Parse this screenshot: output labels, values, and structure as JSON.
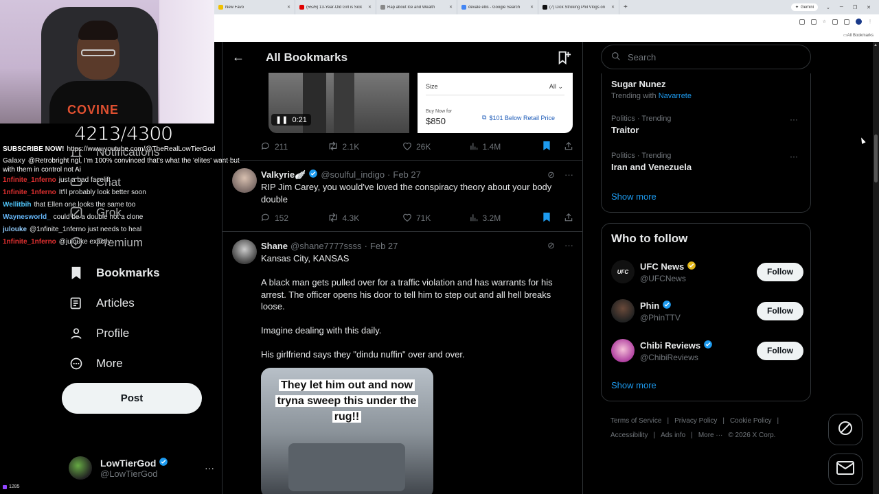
{
  "browser": {
    "tabs": [
      {
        "label": "New Favo",
        "fav_color": "#f0c000"
      },
      {
        "label": "(5526) 13-Year-Old Girl is Sick",
        "fav_color": "#e00000"
      },
      {
        "label": "Rap about Ice and Wealth",
        "fav_color": "#888888"
      },
      {
        "label": "devale ellis - Google Search",
        "fav_color": "#4285f4"
      },
      {
        "label": "(7) Dick Stroking Phil Vlogs on",
        "fav_color": "#111111"
      }
    ],
    "gemini_label": "Gemini",
    "bookmarks_label": "All Bookmarks"
  },
  "stream": {
    "counter": "4213/4300",
    "viewers": "1285",
    "chat": [
      {
        "user": "SUBSCRIBE NOW!",
        "text": "https://www.youtube.com/@TheRealLowTierGod",
        "color": "#ffffff"
      },
      {
        "user": "Galaxy",
        "text": "@Retrobright ngl, I'm 100% convinced that's what the 'elites' want but with them in control not Ai",
        "color": "#b0b0b0"
      },
      {
        "user": "1nfinite_1nferno",
        "text": "just a bad facelift",
        "color": "#e03030"
      },
      {
        "user": "1nfinite_1nferno",
        "text": "It'll probably look better soon",
        "color": "#e03030"
      },
      {
        "user": "Wellitbih",
        "text": "that Ellen one looks the same too",
        "color": "#4fc3f7"
      },
      {
        "user": "Waynesworld_",
        "text": "could be a double not a clone",
        "color": "#64b5f6"
      },
      {
        "user": "julouke",
        "text": "@1nfinite_1nferno just needs to heal",
        "color": "#90caf9"
      },
      {
        "user": "1nfinite_1nferno",
        "text": "@julouke exactly",
        "color": "#e03030"
      }
    ]
  },
  "sidebar": {
    "items": [
      {
        "label": "Notifications",
        "icon": "bell-icon"
      },
      {
        "label": "Chat",
        "icon": "chat-icon"
      },
      {
        "label": "Grok",
        "icon": "grok-icon"
      },
      {
        "label": "Premium",
        "icon": "premium-icon"
      },
      {
        "label": "Bookmarks",
        "icon": "bookmark-icon"
      },
      {
        "label": "Articles",
        "icon": "article-icon"
      },
      {
        "label": "Profile",
        "icon": "person-icon"
      },
      {
        "label": "More",
        "icon": "more-circle-icon"
      }
    ],
    "post_label": "Post",
    "account": {
      "name": "LowTierGod",
      "handle": "@LowTierGod"
    }
  },
  "main": {
    "title": "All Bookmarks",
    "top_media": {
      "video_time": "0:21",
      "ad": {
        "size_label": "Size",
        "size_value": "All",
        "buy_label": "Buy Now for",
        "price": "$850",
        "discount": "$101 Below Retail Price"
      }
    },
    "tweets": [
      {
        "replies": "211",
        "reposts": "2.1K",
        "likes": "26K",
        "views": "1.4M"
      },
      {
        "name": "Valkyrie🪽",
        "handle": "@soulful_indigo",
        "date": "Feb 27",
        "text": "RIP Jim Carey, you would've loved the conspiracy theory about your body double",
        "replies": "152",
        "reposts": "4.3K",
        "likes": "71K",
        "views": "3.2M"
      },
      {
        "name": "Shane",
        "handle": "@shane7777ssss",
        "date": "Feb 27",
        "lines": [
          "Kansas City, KANSAS",
          "A black man gets pulled over for a traffic violation and has warrants for his arrest. The officer opens his door to tell him to step out and all hell breaks loose.",
          "Imagine dealing with this daily.",
          "His girlfriend says they \"dindu nuffin\" over and over."
        ],
        "image_caption": "They let him out and now tryna sweep this under the rug!!"
      }
    ]
  },
  "right": {
    "search_placeholder": "Search",
    "trends": [
      {
        "name": "Sugar Nunez",
        "with_label": "Trending with",
        "with_value": "Navarrete"
      },
      {
        "meta": "Politics · Trending",
        "name": "Traitor"
      },
      {
        "meta": "Politics · Trending",
        "name": "Iran and Venezuela"
      }
    ],
    "show_more": "Show more",
    "who_to_follow_title": "Who to follow",
    "accounts": [
      {
        "name": "UFC News",
        "handle": "@UFCNews",
        "follow": "Follow",
        "badge": "gold"
      },
      {
        "name": "Phin",
        "handle": "@PhinTTV",
        "follow": "Follow",
        "badge": "blue"
      },
      {
        "name": "Chibi Reviews",
        "handle": "@ChibiReviews",
        "follow": "Follow",
        "badge": "blue"
      }
    ],
    "footer": [
      "Terms of Service",
      "Privacy Policy",
      "Cookie Policy",
      "Accessibility",
      "Ads info",
      "More ···",
      "© 2026 X Corp."
    ]
  },
  "colors": {
    "accent": "#1d9bf0",
    "verified_gold": "#e2b719"
  }
}
